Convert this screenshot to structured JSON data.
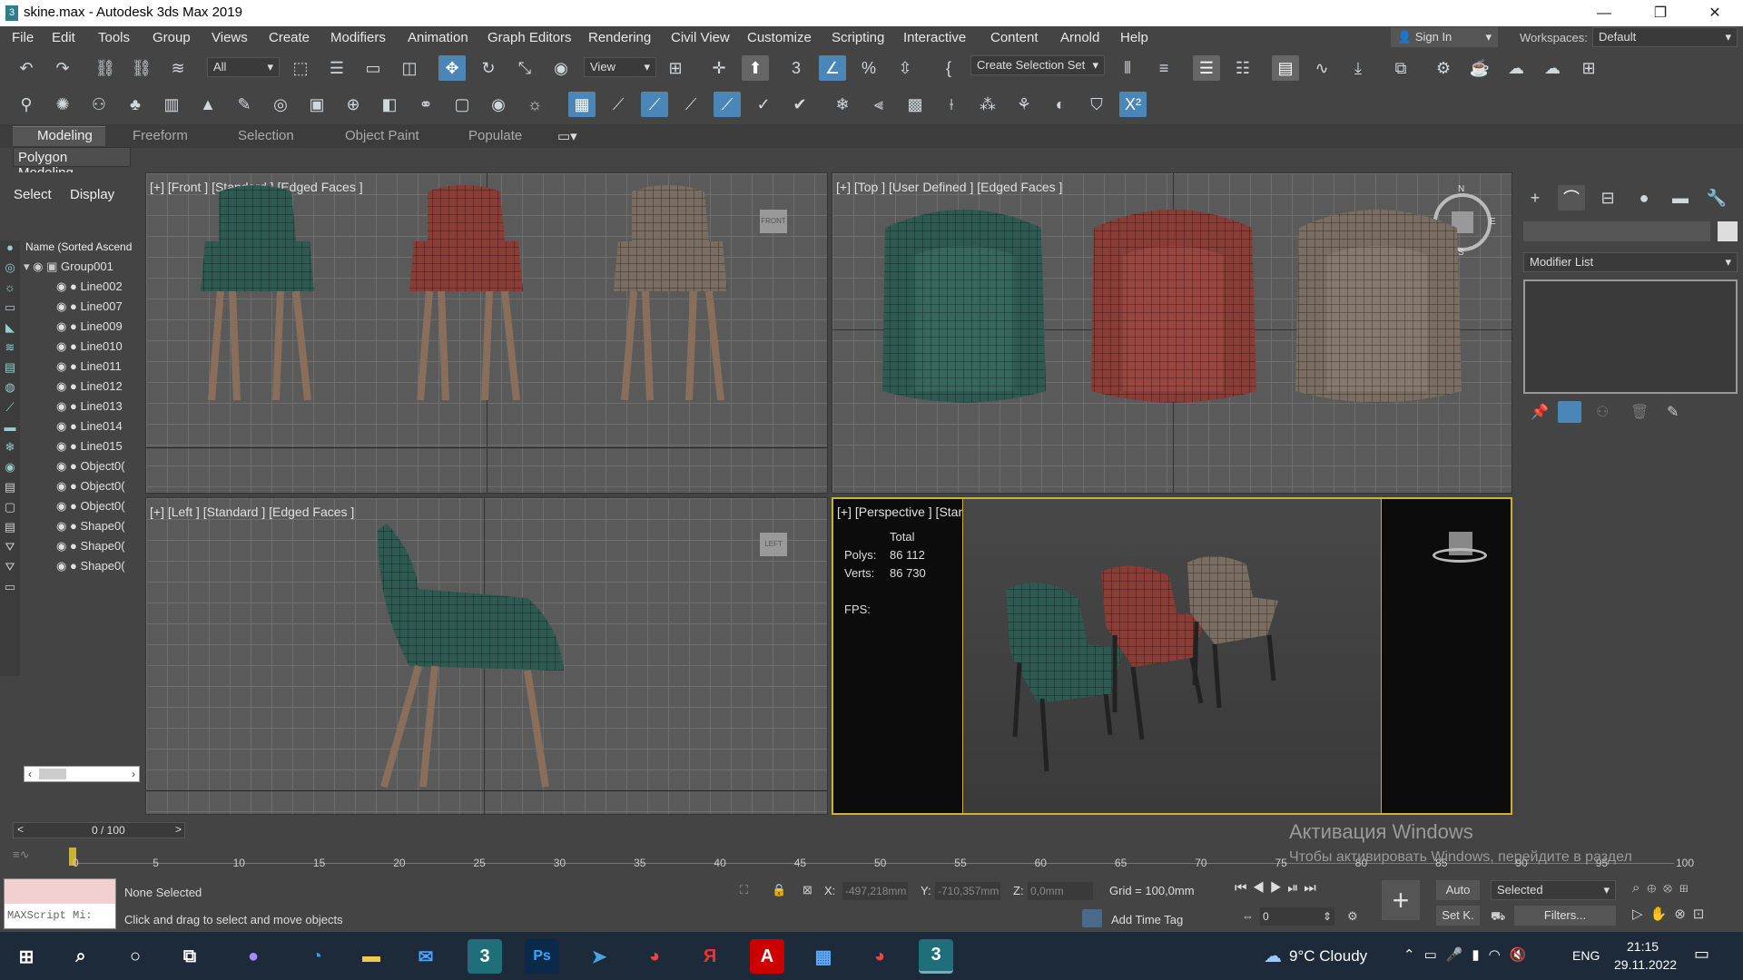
{
  "window": {
    "title": "skine.max - Autodesk 3ds Max 2019",
    "icon": "3",
    "min": "—",
    "max": "❐",
    "close": "✕"
  },
  "menu": [
    "File",
    "Edit",
    "Tools",
    "Group",
    "Views",
    "Create",
    "Modifiers",
    "Animation",
    "Graph Editors",
    "Rendering",
    "Civil View",
    "Customize",
    "Scripting",
    "Interactive",
    "Content",
    "Arnold",
    "Help"
  ],
  "signin": "Sign In",
  "workspace": {
    "label": "Workspaces:",
    "value": "Default"
  },
  "toolbar": {
    "filter": "All",
    "refcoord": "View",
    "selset": "Create Selection Set"
  },
  "ribbon": {
    "tabs": [
      "Modeling",
      "Freeform",
      "Selection",
      "Object Paint",
      "Populate"
    ],
    "sub": "Polygon Modeling"
  },
  "explorer": {
    "tabs": [
      "Select",
      "Display"
    ],
    "header": "Name (Sorted Ascend",
    "root": "Group001",
    "items": [
      "Line002",
      "Line007",
      "Line009",
      "Line010",
      "Line011",
      "Line012",
      "Line013",
      "Line014",
      "Line015",
      "Object0(",
      "Object0(",
      "Object0(",
      "Shape0(",
      "Shape0(",
      "Shape0("
    ]
  },
  "viewports": {
    "front": "[+] [Front ] [Standard ] [Edged Faces ]",
    "top": "[+] [Top ] [User Defined ] [Edged Faces ]",
    "left": "[+] [Left ] [Standard ] [Edged Faces ]",
    "persp": "[+] [Perspective ] [Standard ] [Edged Faces ]"
  },
  "stats": {
    "total": "Total",
    "polys_label": "Polys:",
    "polys": "86 112",
    "verts_label": "Verts:",
    "verts": "86 730",
    "fps": "FPS:"
  },
  "compass": {
    "n": "N",
    "s": "S",
    "e": "E",
    "w": "W"
  },
  "viewcube": {
    "front": "FRONT",
    "left": "LEFT"
  },
  "cmd": {
    "modlist": "Modifier List"
  },
  "timeslider": {
    "value": "0 / 100",
    "prev": "<",
    "next": ">"
  },
  "ticks": [
    "0",
    "5",
    "10",
    "15",
    "20",
    "25",
    "30",
    "35",
    "40",
    "45",
    "50",
    "55",
    "60",
    "65",
    "70",
    "75",
    "80",
    "85",
    "90",
    "95",
    "100"
  ],
  "status": {
    "selected": "None Selected",
    "hint": "Click and drag to select and move objects",
    "maxscript": "MAXScript Mi:",
    "x_label": "X:",
    "x": "-497,218mm",
    "y_label": "Y:",
    "y": "-710,357mm",
    "z_label": "Z:",
    "z": "0,0mm",
    "grid": "Grid = 100,0mm",
    "addtime": "Add Time Tag",
    "auto": "Auto",
    "setk": "Set K.",
    "sel_dd": "Selected",
    "filters": "Filters...",
    "frame": "0"
  },
  "activation": {
    "title": "Активация Windows",
    "sub": "Чтобы активировать Windows, перейдите в раздел \"Параметры\"."
  },
  "taskbar": {
    "weather": "9°C  Cloudy",
    "lang": "ENG",
    "time": "21:15",
    "date": "29.11.2022"
  },
  "colors": {
    "green": "#2f5a52",
    "red": "#8a3c36",
    "beige": "#7a6e62",
    "legs": "#8a6e5c",
    "accent": "#4a86b8",
    "yellow": "#c8b432"
  }
}
